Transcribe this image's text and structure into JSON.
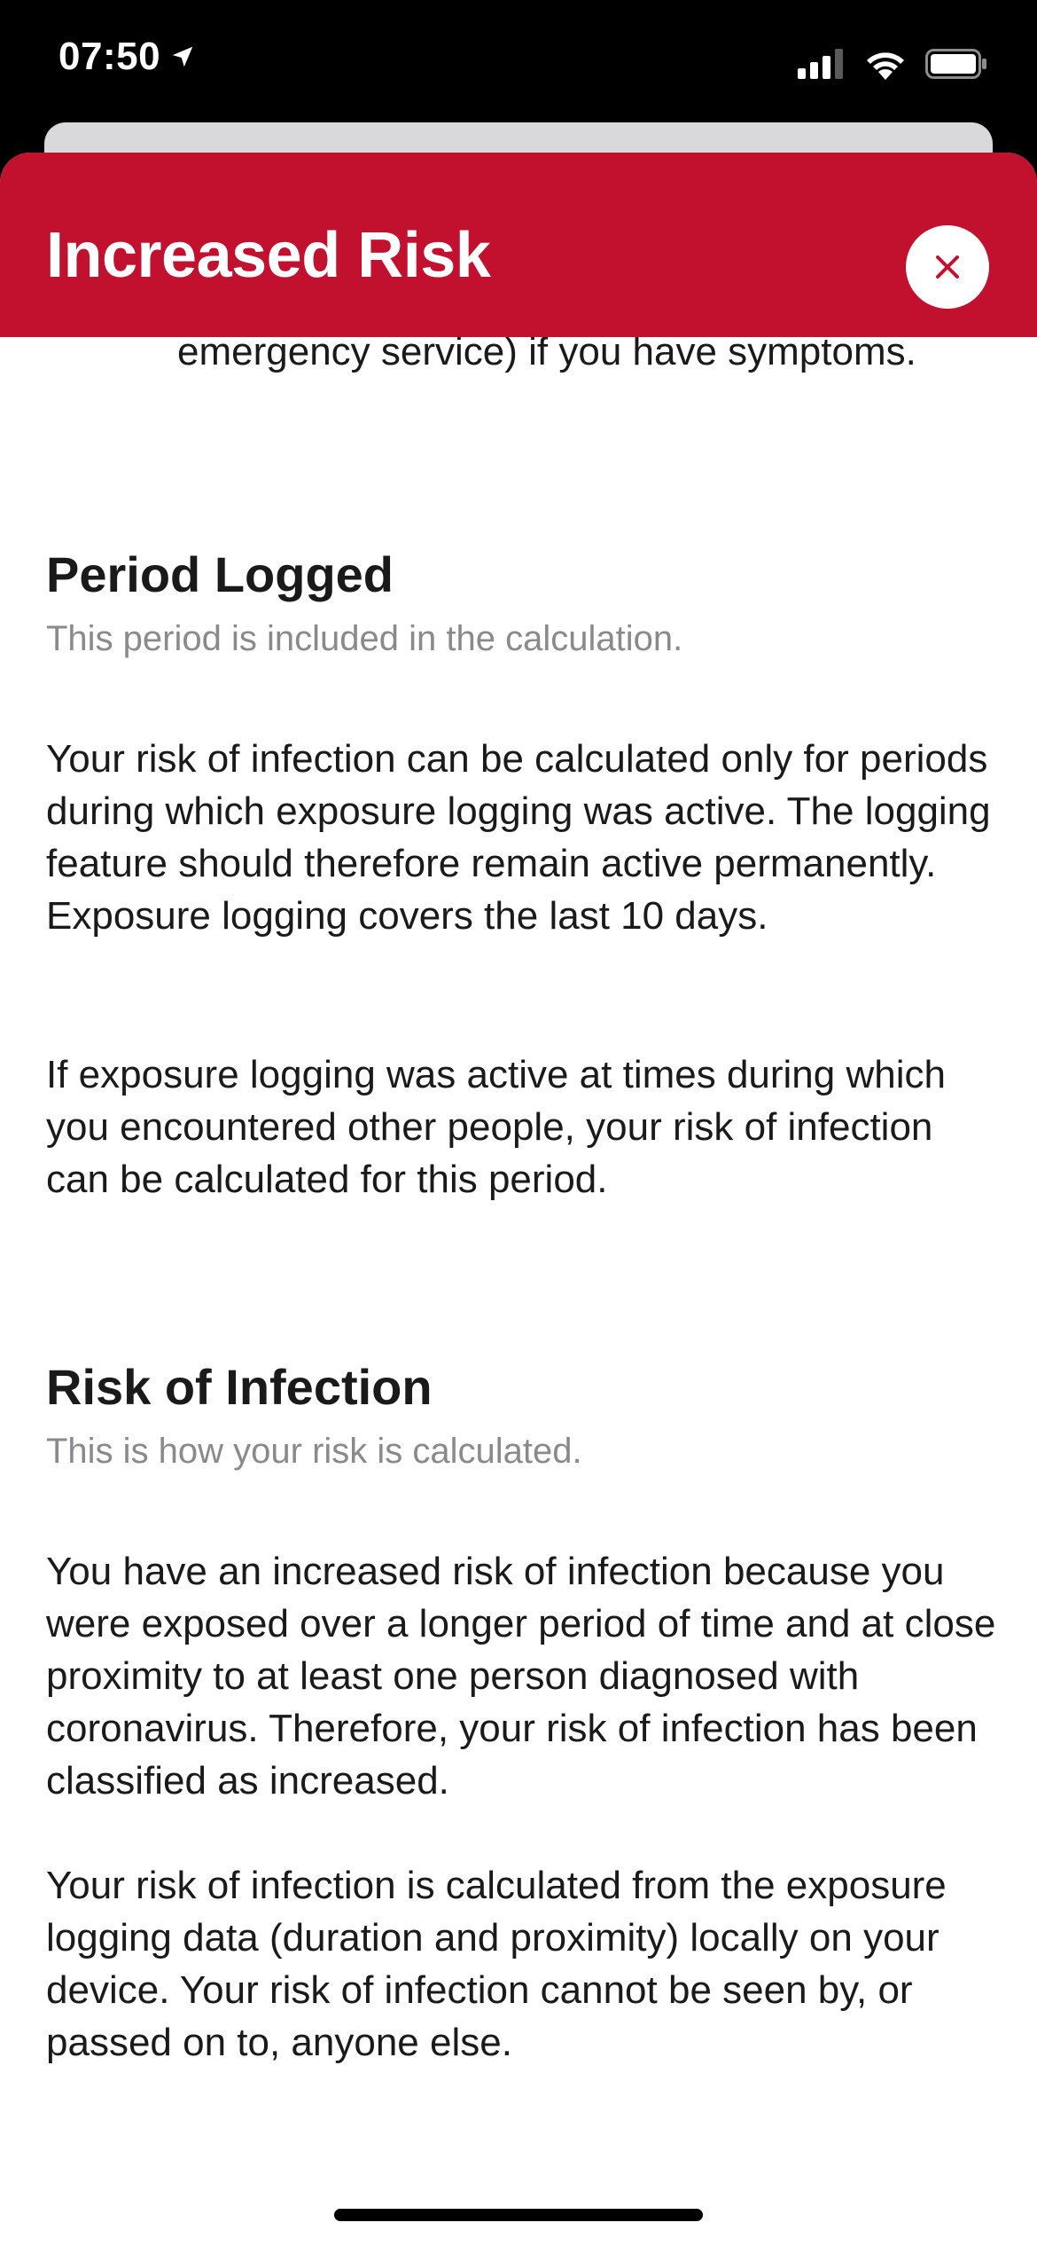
{
  "status_bar": {
    "time": "07:50"
  },
  "modal": {
    "title": "Increased Risk",
    "close_label": "×"
  },
  "content": {
    "bullet_tail": "emergency service) if you have symptoms.",
    "sections": [
      {
        "title": "Period Logged",
        "subtitle": "This period is included in the calculation.",
        "paragraphs": [
          "Your risk of infection can be calculated only for periods during which exposure logging was active. The logging feature should therefore remain active permanently. Exposure logging covers the last 10 days.",
          "If exposure logging was active at times during which you encountered other people, your risk of infection can be calculated for this period."
        ]
      },
      {
        "title": "Risk of Infection",
        "subtitle": "This is how your risk is calculated.",
        "paragraphs": [
          "You have an increased risk of infection because you were exposed over a longer period of time and at close proximity to at least one person diagnosed with coronavirus. Therefore, your risk of infection has been classified as increased.",
          "Your risk of infection is calculated from the exposure logging data (duration and proximity) locally on your device. Your risk of infection cannot be seen by, or passed on to, anyone else."
        ]
      }
    ]
  },
  "colors": {
    "header_red": "#c1112e",
    "text": "#1a1a1a",
    "subtitle_gray": "#8a8a8e"
  },
  "icons": {
    "location": "location-arrow-icon",
    "signal": "cellular-signal-icon",
    "wifi": "wifi-icon",
    "battery": "battery-icon",
    "close": "close-icon"
  }
}
